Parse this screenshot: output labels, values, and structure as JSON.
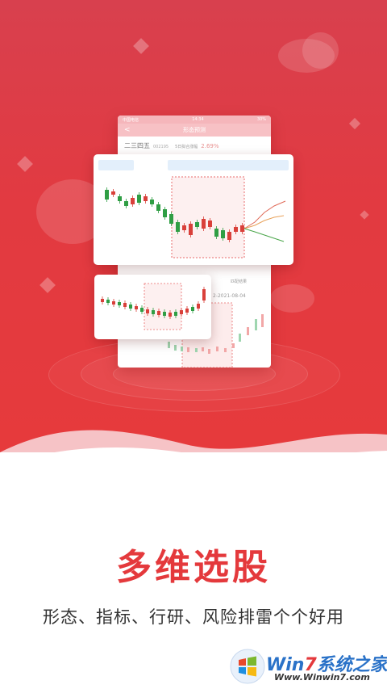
{
  "phone": {
    "status_carrier": "中国电信",
    "status_time": "14:34",
    "status_battery": "30%",
    "nav_back": "<",
    "nav_title": "形态预测",
    "stock_name": "二三四五",
    "stock_code": "002195",
    "forecast_label": "5日拟合涨幅",
    "forecast_value": "2.69%",
    "date_range_text": "2-2021-08-04",
    "section_label": "匹配结果"
  },
  "headline": "多维选股",
  "subline": "形态、指标、行研、风险排雷个个好用",
  "watermark": {
    "title_prefix": "Win",
    "title_seven": "7",
    "title_suffix": "系统之家",
    "url": "Www.Winwin7.com"
  },
  "colors": {
    "brand_red": "#e4393c",
    "candle_red": "#d9403a",
    "candle_green": "#2f9e44",
    "highlight_border": "#e86a6a"
  }
}
